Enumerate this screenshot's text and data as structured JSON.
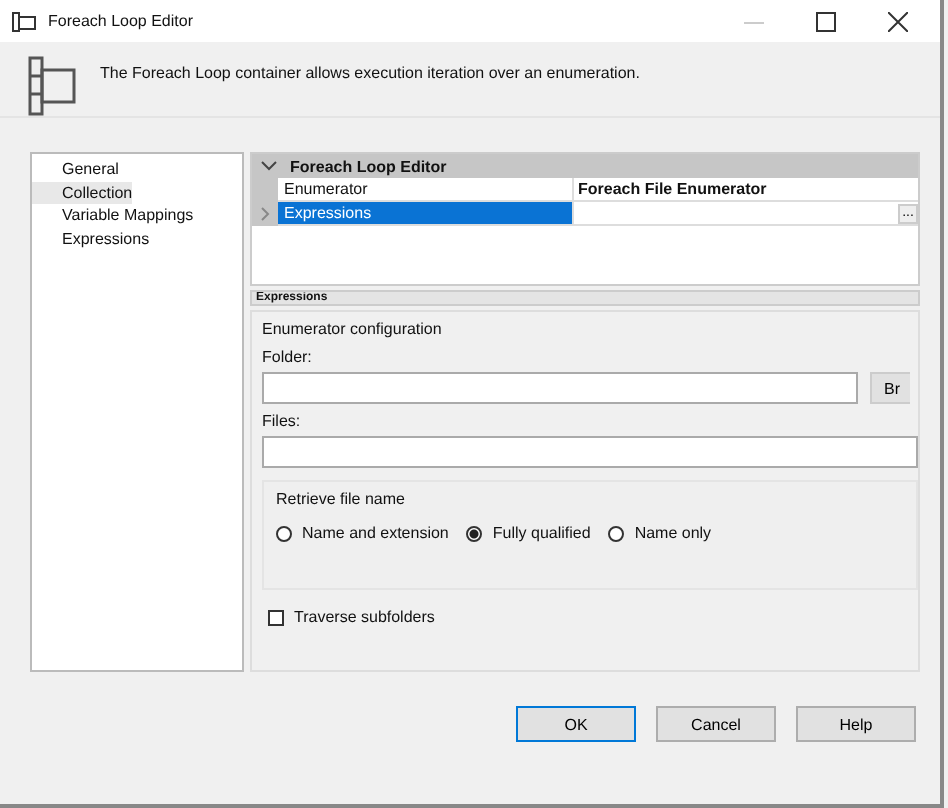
{
  "window": {
    "title": "Foreach Loop Editor"
  },
  "header": {
    "description": "The Foreach Loop container allows execution iteration over an enumeration."
  },
  "sidebar": {
    "items": [
      {
        "label": "General",
        "selected": false
      },
      {
        "label": "Collection",
        "selected": true
      },
      {
        "label": "Variable Mappings",
        "selected": false
      },
      {
        "label": "Expressions",
        "selected": false
      }
    ]
  },
  "property_grid": {
    "category": "Foreach Loop Editor",
    "expanded": true,
    "rows": [
      {
        "name": "Enumerator",
        "value": "Foreach File Enumerator",
        "selected": false,
        "expandable": false
      },
      {
        "name": "Expressions",
        "selected": true,
        "expandable": true,
        "ellipsis": "..."
      }
    ],
    "description_title": "Expressions"
  },
  "enumerator_configuration": {
    "title": "Enumerator configuration",
    "folder": {
      "label": "Folder:",
      "browse": "Br"
    },
    "files": {
      "label": "Files:"
    },
    "retrieve_file_name": {
      "title": "Retrieve file name",
      "options": [
        {
          "label": "Name and extension",
          "selected": false
        },
        {
          "label": "Fully qualified",
          "selected": true
        },
        {
          "label": "Name only",
          "selected": false
        }
      ]
    },
    "traverse_subfolders": {
      "label": "Traverse subfolders",
      "checked": false
    }
  },
  "buttons": [
    {
      "label": "OK",
      "default": true
    },
    {
      "label": "Cancel",
      "default": false
    },
    {
      "label": "Help",
      "default": false
    }
  ]
}
